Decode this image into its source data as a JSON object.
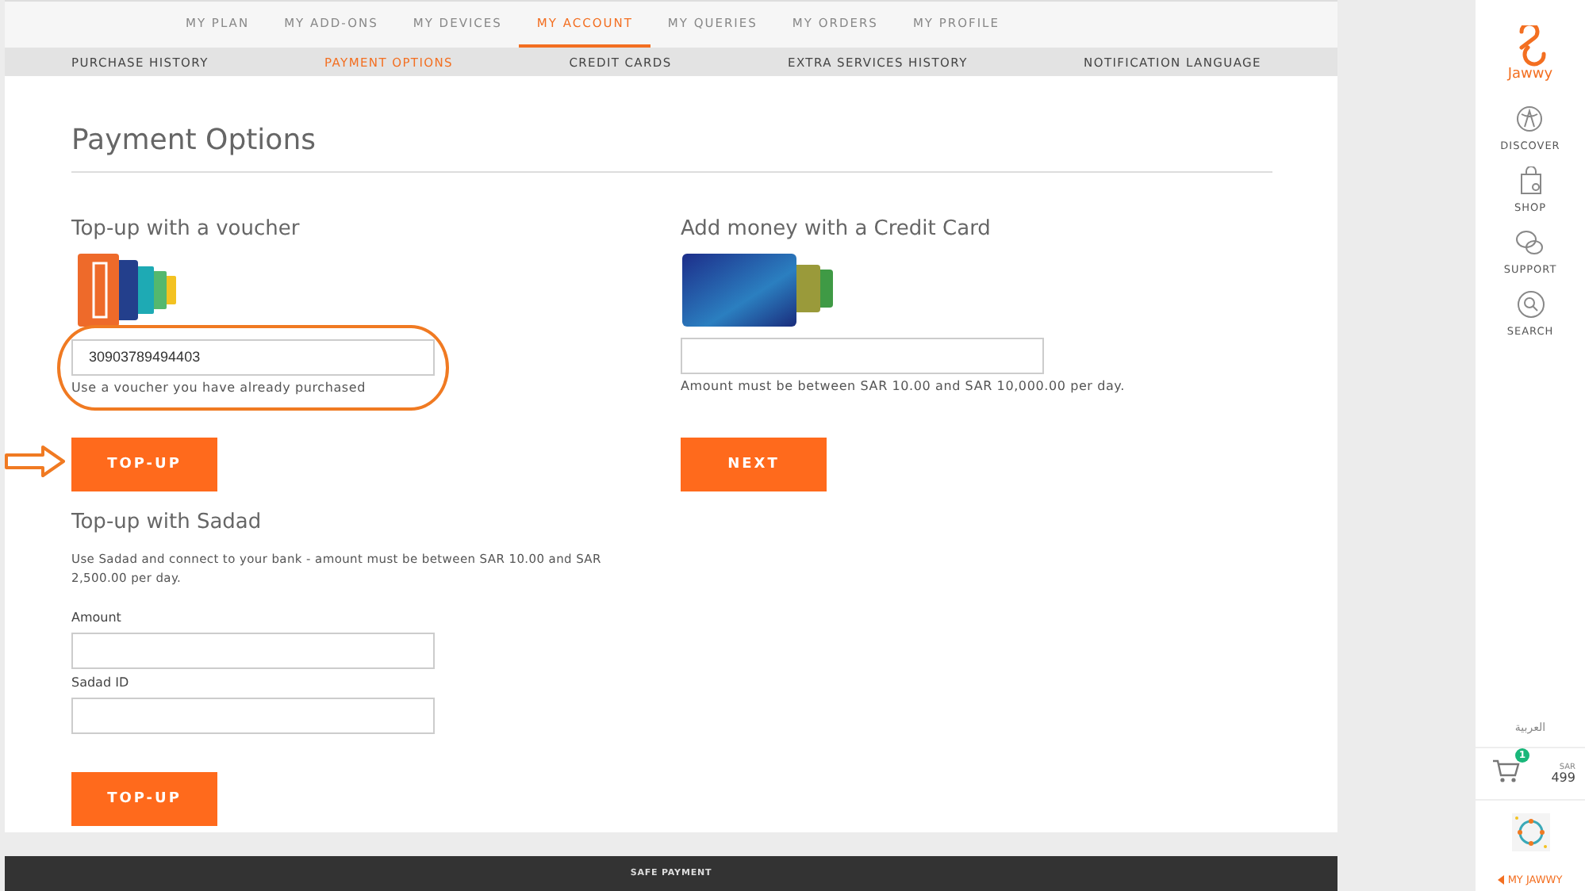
{
  "top_nav": [
    {
      "label": "MY PLAN",
      "selected": false
    },
    {
      "label": "MY ADD-ONS",
      "selected": false
    },
    {
      "label": "MY DEVICES",
      "selected": false
    },
    {
      "label": "MY ACCOUNT",
      "selected": true
    },
    {
      "label": "MY QUERIES",
      "selected": false
    },
    {
      "label": "MY ORDERS",
      "selected": false
    },
    {
      "label": "MY PROFILE",
      "selected": false
    }
  ],
  "sub_nav": [
    {
      "label": "PURCHASE HISTORY",
      "selected": false
    },
    {
      "label": "PAYMENT OPTIONS",
      "selected": true
    },
    {
      "label": "CREDIT CARDS",
      "selected": false
    },
    {
      "label": "EXTRA SERVICES HISTORY",
      "selected": false
    },
    {
      "label": "NOTIFICATION LANGUAGE",
      "selected": false
    }
  ],
  "page_title": "Payment Options",
  "voucher": {
    "heading": "Top-up with a voucher",
    "value": "30903789494403",
    "hint": "Use a voucher you have already purchased",
    "button": "TOP-UP",
    "highlighted": true
  },
  "credit_card": {
    "heading": "Add money with a Credit Card",
    "hint": "Amount must be between SAR 10.00 and SAR 10,000.00 per day.",
    "button": "NEXT"
  },
  "sadad": {
    "heading": "Top-up with Sadad",
    "description": "Use Sadad and connect to your bank - amount must be between SAR 10.00 and SAR 2,500.00 per day.",
    "fields": [
      {
        "label": "Amount"
      },
      {
        "label": "Sadad ID"
      }
    ],
    "button": "TOP-UP"
  },
  "footer": {
    "text": "SAFE PAYMENT"
  },
  "sidebar": {
    "logo": "Jawwy",
    "items": [
      {
        "label": "DISCOVER",
        "kind": "discover"
      },
      {
        "label": "SHOP",
        "kind": "shop"
      },
      {
        "label": "SUPPORT",
        "kind": "support"
      },
      {
        "label": "SEARCH",
        "kind": "search"
      }
    ],
    "language": "العربية",
    "cart": {
      "count": "1",
      "currency": "SAR",
      "amount": "499"
    },
    "account_link": "MY JAWWY"
  }
}
